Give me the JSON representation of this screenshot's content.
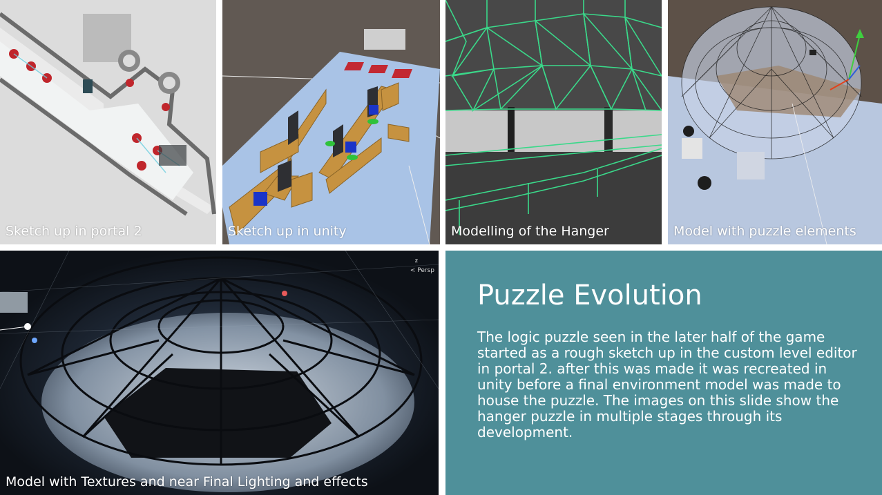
{
  "captions": {
    "portal2": "Sketch up in portal 2",
    "unity": "Sketch up in unity",
    "hanger": "Modelling of the Hanger",
    "puzzle": "Model with puzzle elements",
    "final": "Model with Textures and near Final Lighting and effects"
  },
  "panel": {
    "title": "Puzzle Evolution",
    "body": "The logic puzzle seen in the later half of the game started as a rough sketch up in the custom level editor in portal 2. after this was made it was recreated in unity before a final environment model was made to house the puzzle. The images on this slide show the hanger puzzle in multiple stages through its development.",
    "background": "#4f909a"
  },
  "viewport": {
    "persp_label": "< Persp",
    "axis_label": "z"
  }
}
